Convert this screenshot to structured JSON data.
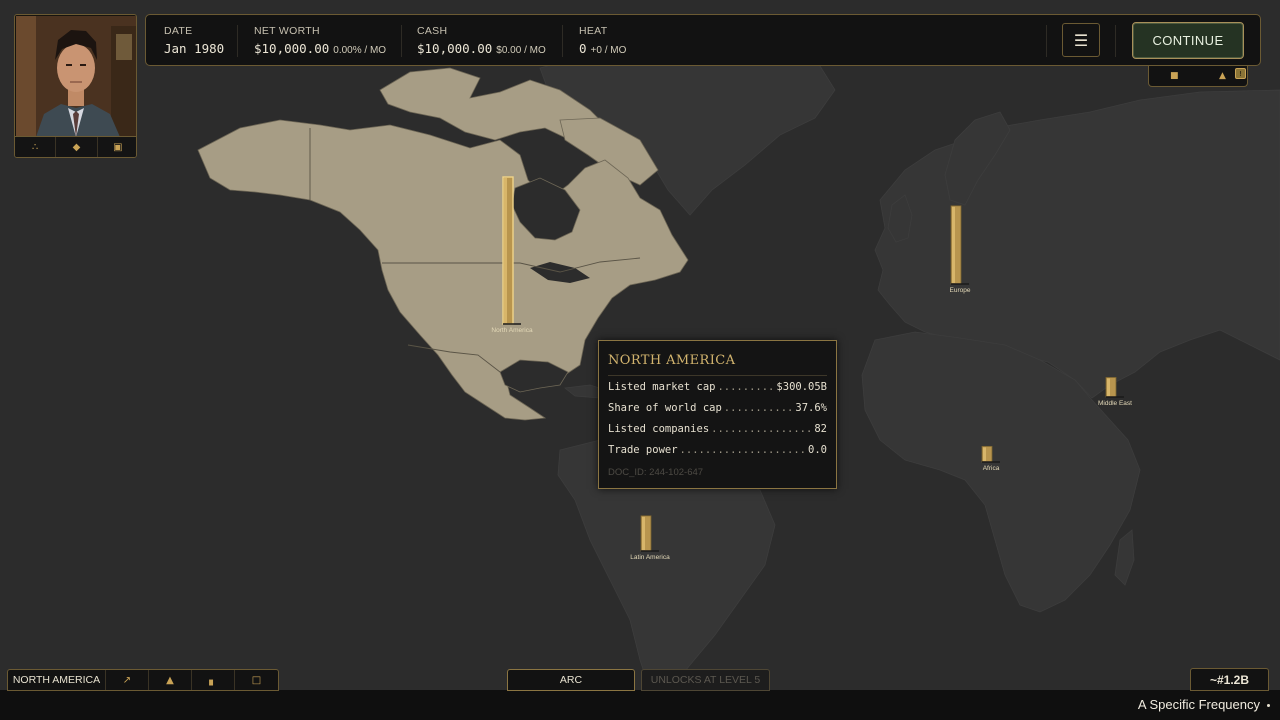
{
  "portrait": {
    "actions": [
      "network-icon",
      "gem-icon",
      "briefcase-icon"
    ]
  },
  "topbar": {
    "date": {
      "label": "DATE",
      "value": "Jan 1980"
    },
    "net_worth": {
      "label": "NET WORTH",
      "value": "$10,000.00",
      "change": "0.00% / MO"
    },
    "cash": {
      "label": "CASH",
      "value": "$10,000.00",
      "change": "$0.00 / MO"
    },
    "heat": {
      "label": "HEAT",
      "value": "0",
      "change": "+0 / MO"
    },
    "menu_icon": "hamburger-menu-icon",
    "continue_label": "CONTINUE"
  },
  "mini_bar": {
    "icons": [
      "calendar-icon",
      "house-icon"
    ],
    "badge": "!"
  },
  "regions": [
    {
      "name": "North America",
      "market_share": 0.376,
      "selected": true
    },
    {
      "name": "Europe",
      "market_share": 0.2
    },
    {
      "name": "Middle East",
      "market_share": 0.05
    },
    {
      "name": "Africa",
      "market_share": 0.04
    },
    {
      "name": "Latin America",
      "market_share": 0.09
    }
  ],
  "tooltip": {
    "title": "NORTH AMERICA",
    "rows": [
      {
        "label": "Listed market cap",
        "value": "$300.05B"
      },
      {
        "label": "Share of world cap",
        "value": "37.6%"
      },
      {
        "label": "Listed companies",
        "value": "82"
      },
      {
        "label": "Trade power",
        "value": "0.0"
      }
    ],
    "doc_id": "DOC_ID: 244-102-647"
  },
  "bottom": {
    "region_tab": "NORTH AMERICA",
    "region_icons": [
      "chart-line-icon",
      "bell-icon",
      "factory-icon",
      "document-icon"
    ],
    "arc_label": "ARC",
    "unlock_label": "UNLOCKS AT LEVEL 5",
    "price": "~#1.2B",
    "ticker": "A Specific Frequency"
  },
  "colors": {
    "ocean": "#2c2c2c",
    "land": "#363636",
    "land_highlight": "#a79d85",
    "gold": "#c9a356",
    "panel": "#121212",
    "border": "#6b5a33"
  }
}
